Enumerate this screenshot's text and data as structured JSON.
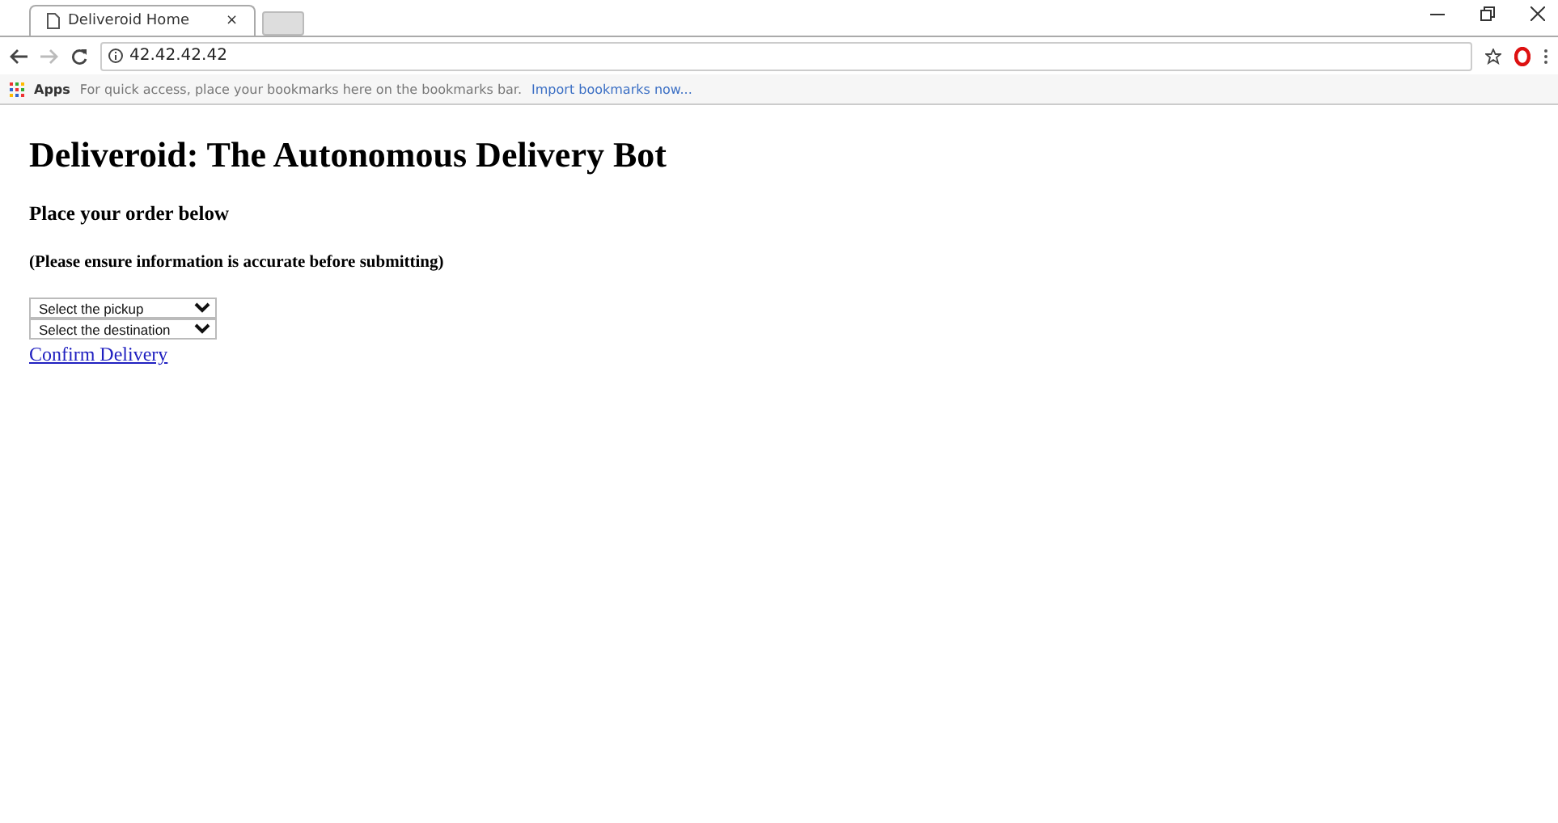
{
  "tabs": [
    {
      "title": "Deliveroid Home",
      "close": "×",
      "selected": true
    }
  ],
  "address_bar": {
    "value": "42.42.42.42"
  },
  "bookmarks_bar": {
    "apps": "Apps",
    "hint": "For quick access, place your bookmarks here on the bookmarks bar.",
    "import_link": "Import bookmarks now..."
  },
  "page": {
    "title": "Deliveroid: The Autonomous Delivery Bot",
    "subtitle": "Place your order below",
    "note": "(Please ensure information is accurate before submitting)",
    "selects": [
      {
        "value": "Select the pickup"
      },
      {
        "value": "Select the destination"
      }
    ],
    "link": "Confirm Delivery"
  }
}
